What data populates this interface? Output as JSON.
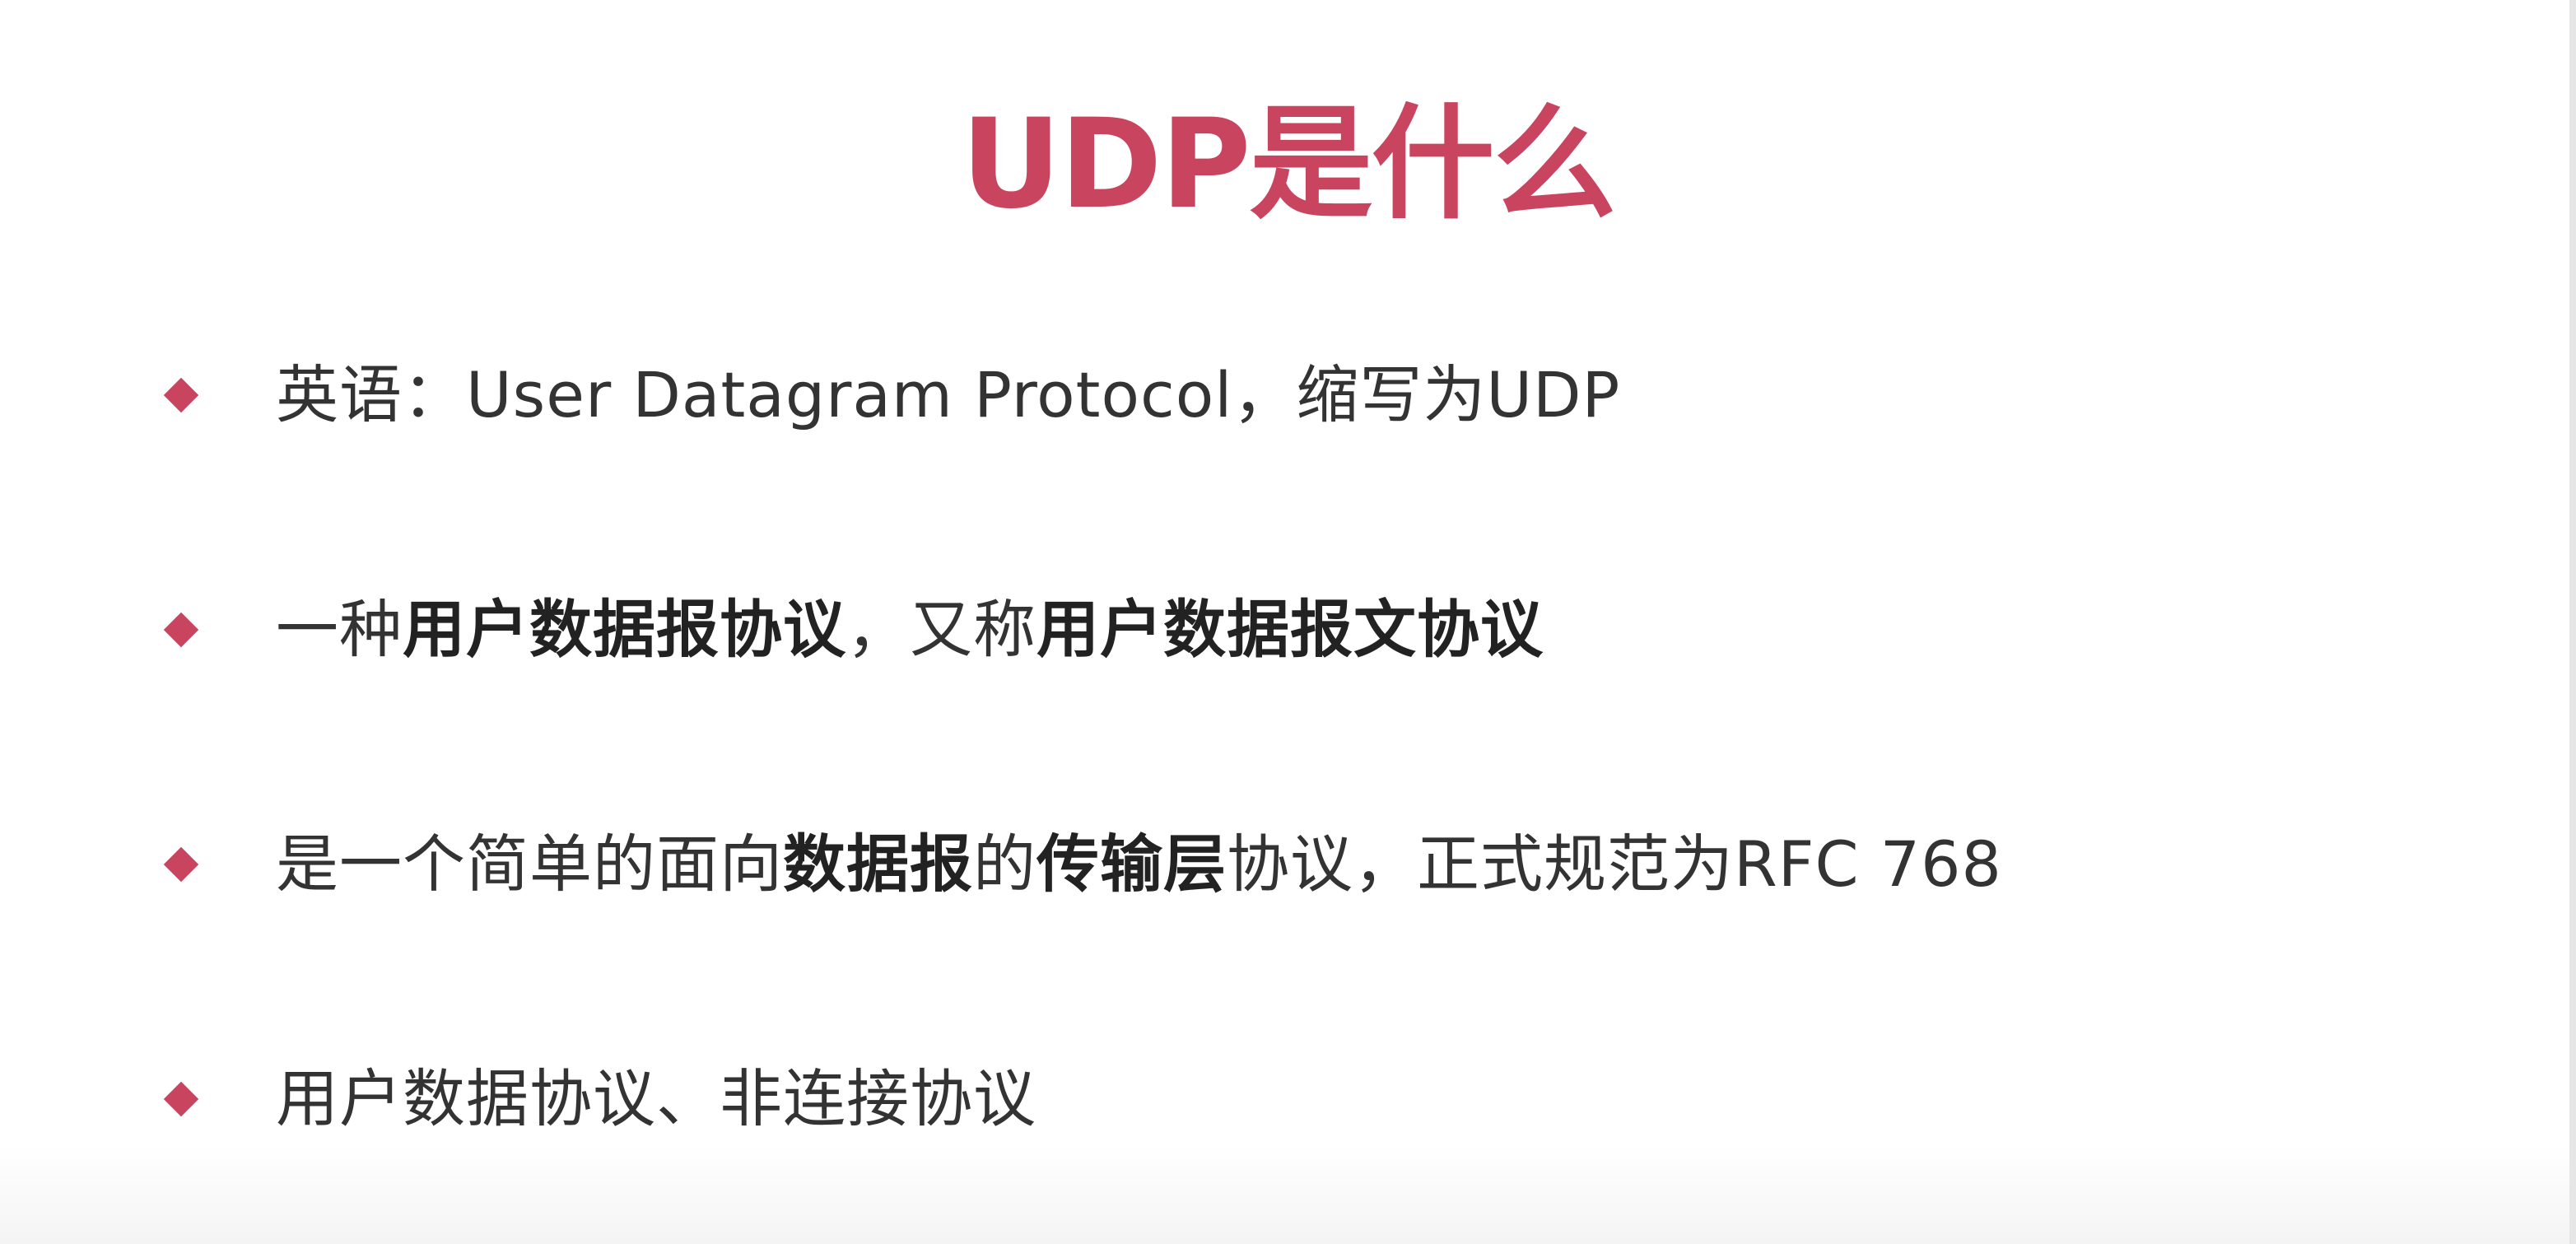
{
  "slide": {
    "title": "UDP是什么",
    "bullets": [
      {
        "segments": [
          {
            "text": "英语：User Datagram Protocol，缩写为UDP",
            "bold": false
          }
        ]
      },
      {
        "segments": [
          {
            "text": "一种",
            "bold": false
          },
          {
            "text": "用户数据报协议",
            "bold": true
          },
          {
            "text": "，又称",
            "bold": false
          },
          {
            "text": "用户数据报文协议",
            "bold": true
          }
        ]
      },
      {
        "segments": [
          {
            "text": "是一个简单的面向",
            "bold": false
          },
          {
            "text": "数据报",
            "bold": true
          },
          {
            "text": "的",
            "bold": false
          },
          {
            "text": "传输层",
            "bold": true
          },
          {
            "text": "协议，正式规范为RFC 768",
            "bold": false
          }
        ]
      },
      {
        "segments": [
          {
            "text": "用户数据协议、非连接协议",
            "bold": false
          }
        ]
      }
    ]
  },
  "colors": {
    "accent": "#c9455f",
    "text": "#333333"
  },
  "icons": {
    "bullet": "diamond-bullet-icon"
  }
}
